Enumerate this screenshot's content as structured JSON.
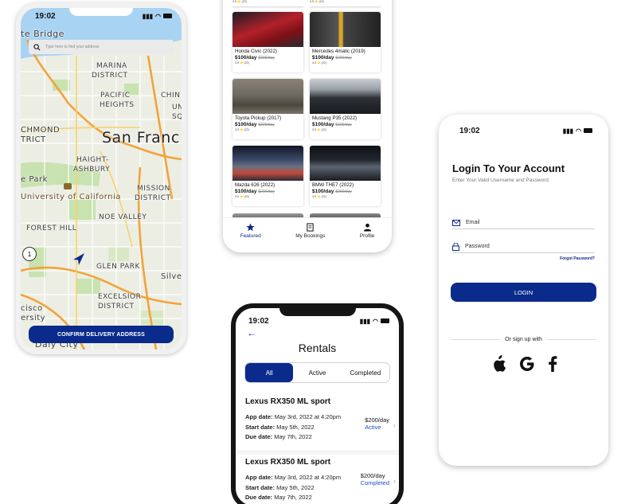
{
  "status_time": "19:02",
  "map_screen": {
    "search_placeholder": "Type here to find your address",
    "labels": {
      "golden_gate": "te Bridge",
      "marina": "MARINA",
      "marina2": "DISTRICT",
      "pacific": "PACIFIC",
      "heights": "HEIGHTS",
      "chin": "CHIN",
      "un": "UN",
      "sq": "SQ",
      "richmond": "CHMOND",
      "richmond2": "TRICT",
      "sf": "San Franc",
      "haight": "HAIGHT-",
      "ashbury": "ASHBURY",
      "park": "e Park",
      "uc": "University of California",
      "mission": "MISSION",
      "district": "DISTRICT",
      "noe": "NOE VALLEY",
      "forest": "FOREST HILL",
      "glen": "GLEN PARK",
      "silv": "Silve",
      "excelsior": "EXCELSIOR",
      "excelsior2": "DISTRICT",
      "cisco": "cisco",
      "ersity": "ersity",
      "daly": "Daly City",
      "route_badge": "1"
    },
    "confirm_button": "CONFIRM DELIVERY ADDRESS"
  },
  "cars_screen": {
    "top_rating_left": "3.5 ⭐ (22)",
    "top_rating_right": "3.5 ⭐ (22)",
    "cars": [
      {
        "name": "Honda Civic (2022)",
        "price": "$100/day",
        "old_price": "$200/day",
        "rating": "3.5 ⭐ (22)",
        "color": "#b3212b"
      },
      {
        "name": "Mercedes 4matic (2019)",
        "price": "$100/day",
        "old_price": "$200/day",
        "rating": "3.5 ⭐ (22)",
        "color": "#3b3b3b"
      },
      {
        "name": "Toyota Pickup (2017)",
        "price": "$100/day",
        "old_price": "$200/day",
        "rating": "3.5 ⭐ (22)",
        "color": "#6d6a62"
      },
      {
        "name": "Mustang P35 (2022)",
        "price": "$100/day",
        "old_price": "$200/day",
        "rating": "3.5 ⭐ (22)",
        "color": "#2d3035"
      },
      {
        "name": "Mazda 626 (2022)",
        "price": "$100/day",
        "old_price": "$200/day",
        "rating": "3.5 ⭐ (22)",
        "color": "#5a6070"
      },
      {
        "name": "BMW THE7 (2022)",
        "price": "$100/day",
        "old_price": "$200/day",
        "rating": "3.5 ⭐ (22)",
        "color": "#22262d"
      }
    ],
    "tabs": {
      "featured": "Featured",
      "bookings": "My Bookings",
      "profile": "Profile"
    }
  },
  "rentals_screen": {
    "title": "Rentals",
    "segments": {
      "all": "All",
      "active": "Active",
      "completed": "Completed"
    },
    "items": [
      {
        "title": "Lexus RX350 ML sport",
        "app_label": "App date:",
        "app_value": " May 3rd, 2022 at 4:20pm",
        "start_label": "Start date:",
        "start_value": " May 5th, 2022",
        "due_label": "Due date:",
        "due_value": " May 7th, 2022",
        "price": "$200/day",
        "status": "Active"
      },
      {
        "title": "Lexus RX350 ML sport",
        "app_label": "App date:",
        "app_value": " May 3rd, 2022 at 4:20pm",
        "start_label": "Start date:",
        "start_value": " May 5th, 2022",
        "due_label": "Due date:",
        "due_value": " May 7th, 2022",
        "price": "$200/day",
        "status": "Completed"
      }
    ]
  },
  "login_screen": {
    "title": "Login To Your Account",
    "subtitle": "Enter Your Valid Username and Password",
    "email_placeholder": "Email",
    "password_placeholder": "Password",
    "forgot": "Forgot Password?",
    "login_button": "LOGIN",
    "or_sign_up": "Or sign up with"
  },
  "colors": {
    "primary": "#0a2a8c",
    "status_blue": "#1e50c8"
  }
}
